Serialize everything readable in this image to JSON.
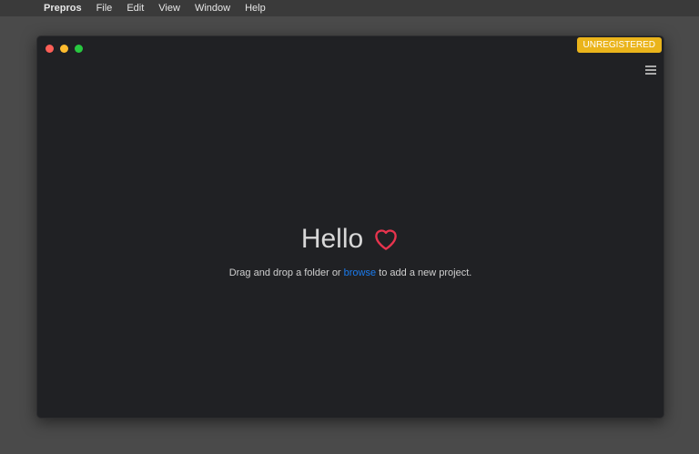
{
  "menubar": {
    "apple": "",
    "app": "Prepros",
    "items": [
      "File",
      "Edit",
      "View",
      "Window",
      "Help"
    ]
  },
  "window": {
    "badge": "UNREGISTERED"
  },
  "main": {
    "title": "Hello",
    "text_before": "Drag and drop a folder or ",
    "link": "browse",
    "text_after": " to add a new project."
  },
  "colors": {
    "accent": "#eab41b",
    "heart": "#e8344e",
    "link": "#1a7cf0"
  }
}
